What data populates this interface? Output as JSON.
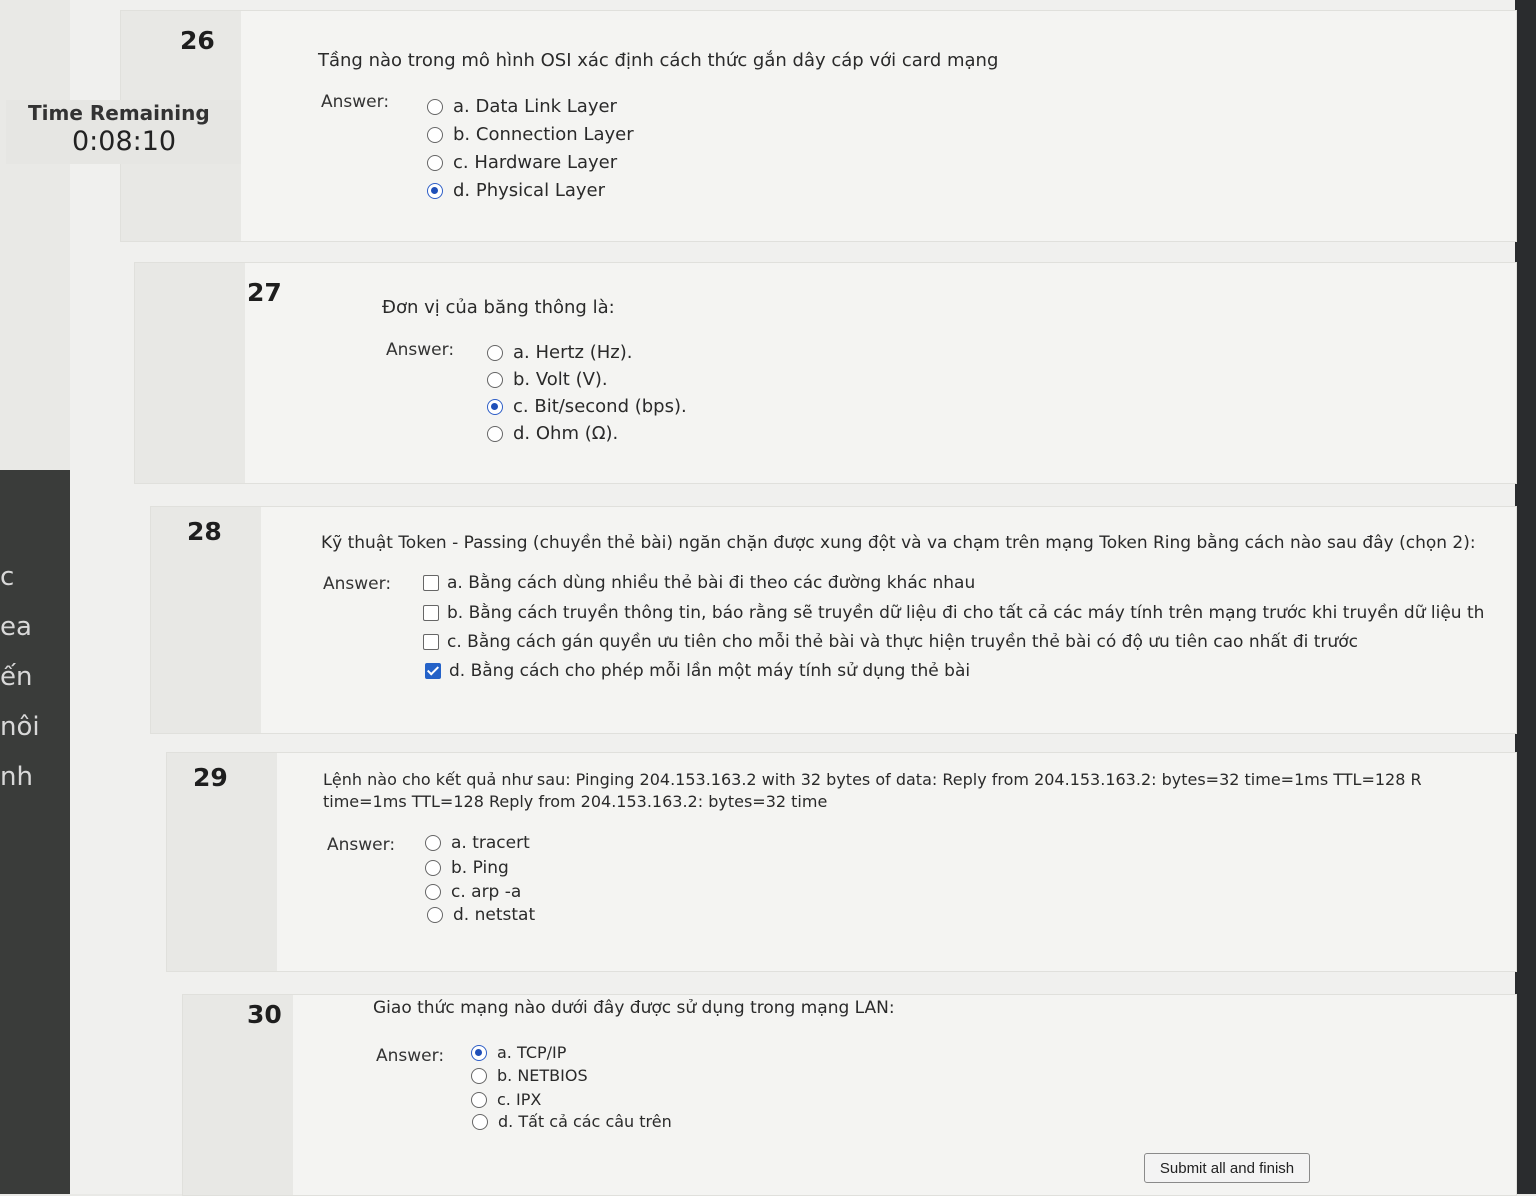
{
  "timer": {
    "title": "Time Remaining",
    "value": "0:08:10"
  },
  "side_fragments": [
    "c",
    "ea",
    "ến",
    "nôi",
    "nh"
  ],
  "questions": [
    {
      "number": "26",
      "text": "Tầng nào trong mô hình OSI xác định cách thức gắn dây cáp với card mạng",
      "answer_label": "Answer:",
      "type": "radio",
      "options": [
        {
          "label": "a. Data Link Layer",
          "checked": false
        },
        {
          "label": "b. Connection Layer",
          "checked": false
        },
        {
          "label": "c. Hardware Layer",
          "checked": false
        },
        {
          "label": "d. Physical Layer",
          "checked": true
        }
      ]
    },
    {
      "number": "27",
      "text": "Đơn vị của băng thông là:",
      "answer_label": "Answer:",
      "type": "radio",
      "options": [
        {
          "label": "a. Hertz (Hz).",
          "checked": false
        },
        {
          "label": "b. Volt (V).",
          "checked": false
        },
        {
          "label": "c. Bit/second (bps).",
          "checked": true
        },
        {
          "label": "d. Ohm (Ω).",
          "checked": false
        }
      ]
    },
    {
      "number": "28",
      "text": "Kỹ thuật Token - Passing (chuyền thẻ bài) ngăn chặn được xung đột và va chạm trên mạng Token Ring bằng cách nào sau đây (chọn 2):",
      "answer_label": "Answer:",
      "type": "checkbox",
      "options": [
        {
          "label": "a. Bằng cách dùng nhiều thẻ bài đi theo các đường khác nhau",
          "checked": false
        },
        {
          "label": "b. Bằng cách truyền thông tin, báo rằng sẽ truyền dữ liệu đi cho tất cả các máy tính trên mạng trước khi truyền dữ liệu th",
          "checked": false
        },
        {
          "label": "c. Bằng cách gán quyền ưu tiên cho mỗi thẻ bài và thực hiện truyền thẻ bài có độ ưu tiên cao nhất đi trước",
          "checked": false
        },
        {
          "label": "d. Bằng cách cho phép mỗi lần một máy tính sử dụng thẻ bài",
          "checked": true
        }
      ]
    },
    {
      "number": "29",
      "text": "Lệnh nào cho kết quả như sau: Pinging 204.153.163.2 with 32 bytes of data: Reply from 204.153.163.2: bytes=32 time=1ms TTL=128 R",
      "text2": "time=1ms TTL=128 Reply from 204.153.163.2: bytes=32 time",
      "answer_label": "Answer:",
      "type": "radio",
      "options": [
        {
          "label": "a. tracert",
          "checked": false
        },
        {
          "label": "b. Ping",
          "checked": false
        },
        {
          "label": "c. arp -a",
          "checked": false
        },
        {
          "label": "d. netstat",
          "checked": false
        }
      ]
    },
    {
      "number": "30",
      "text": "Giao thức mạng nào dưới đây được sử dụng trong mạng LAN:",
      "answer_label": "Answer:",
      "type": "radio",
      "options": [
        {
          "label": "a. TCP/IP",
          "checked": true
        },
        {
          "label": "b. NETBIOS",
          "checked": false
        },
        {
          "label": "c. IPX",
          "checked": false
        },
        {
          "label": "d. Tất cả các câu trên",
          "checked": false
        }
      ]
    }
  ],
  "submit_label": "Submit all and finish"
}
